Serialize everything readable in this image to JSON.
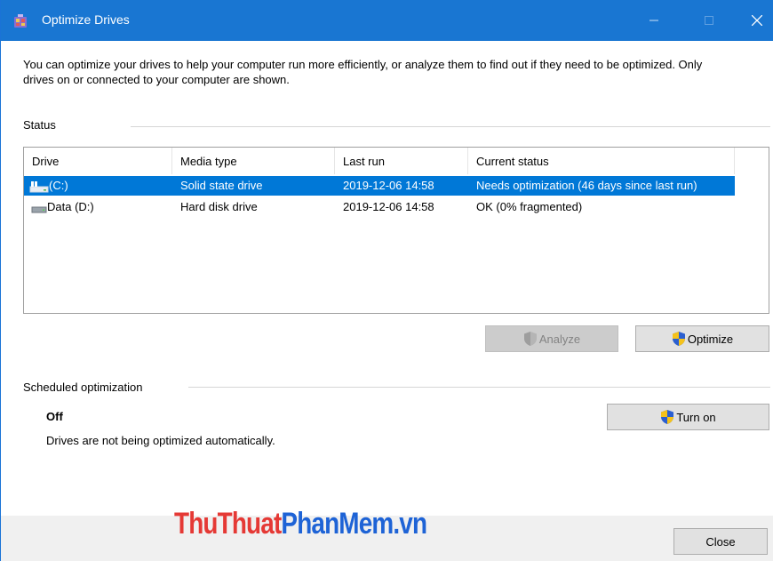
{
  "window": {
    "title": "Optimize Drives",
    "description": "You can optimize your drives to help your computer run more efficiently, or analyze them to find out if they need to be optimized. Only drives on or connected to your computer are shown."
  },
  "status": {
    "section_label": "Status",
    "columns": [
      "Drive",
      "Media type",
      "Last run",
      "Current status"
    ],
    "rows": [
      {
        "drive": "(C:)",
        "media_type": "Solid state drive",
        "last_run": "2019-12-06 14:58",
        "current_status": "Needs optimization (46 days since last run)",
        "selected": true,
        "icon": "system-drive-icon"
      },
      {
        "drive": "Data (D:)",
        "media_type": "Hard disk drive",
        "last_run": "2019-12-06 14:58",
        "current_status": "OK (0% fragmented)",
        "selected": false,
        "icon": "hard-disk-icon"
      }
    ]
  },
  "buttons": {
    "analyze": "Analyze",
    "optimize": "Optimize",
    "turn_on": "Turn on",
    "close": "Close"
  },
  "scheduled": {
    "section_label": "Scheduled optimization",
    "state": "Off",
    "description": "Drives are not being optimized automatically."
  },
  "watermark": {
    "part1": "ThuThuat",
    "part2": "PhanMem",
    "part3": ".vn"
  },
  "colors": {
    "titlebar": "#1976d2",
    "selection": "#0078d7",
    "watermark_red": "#e53935",
    "watermark_blue": "#1e63d6"
  }
}
